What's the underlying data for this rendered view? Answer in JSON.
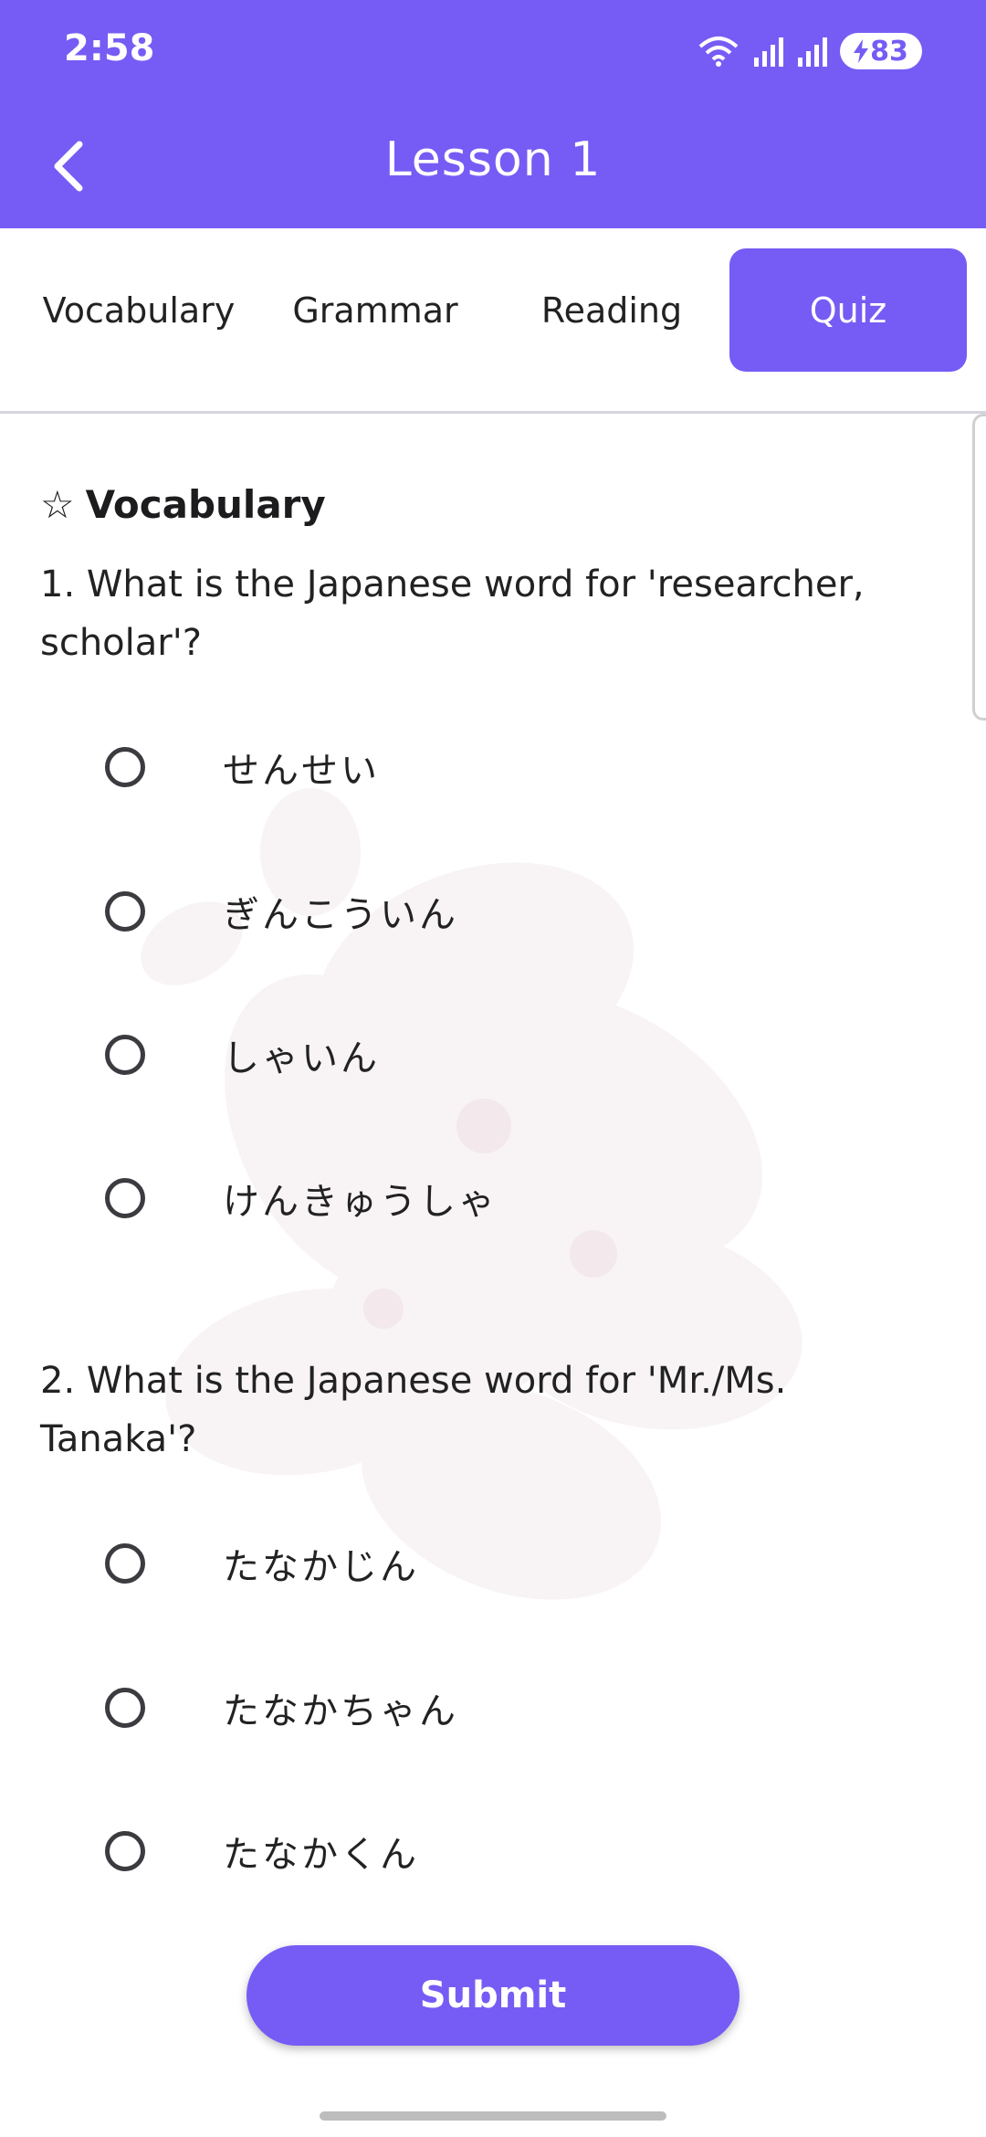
{
  "status_bar": {
    "time": "2:58",
    "battery": "83",
    "icons": [
      "wifi-icon",
      "signal-icon",
      "signal-icon",
      "battery-icon"
    ]
  },
  "app_bar": {
    "title": "Lesson 1",
    "back_icon": "chevron-left-icon"
  },
  "tabs": [
    {
      "label": "Vocabulary",
      "active": false
    },
    {
      "label": "Grammar",
      "active": false
    },
    {
      "label": "Reading",
      "active": false
    },
    {
      "label": "Quiz",
      "active": true
    }
  ],
  "quiz": {
    "section_icon": "☆",
    "section_title": "Vocabulary",
    "questions": [
      {
        "text": "1. What is the Japanese word for 'researcher, scholar'?",
        "options": [
          "せんせい",
          "ぎんこういん",
          "しゃいん",
          "けんきゅうしゃ"
        ]
      },
      {
        "text": "2. What is the Japanese word for 'Mr./Ms. Tanaka'?",
        "options": [
          "たなかじん",
          "たなかちゃん",
          "たなかくん"
        ]
      }
    ]
  },
  "submit_label": "Submit",
  "colors": {
    "accent": "#765bf5",
    "text": "#222222",
    "divider": "#d6d4dc"
  }
}
